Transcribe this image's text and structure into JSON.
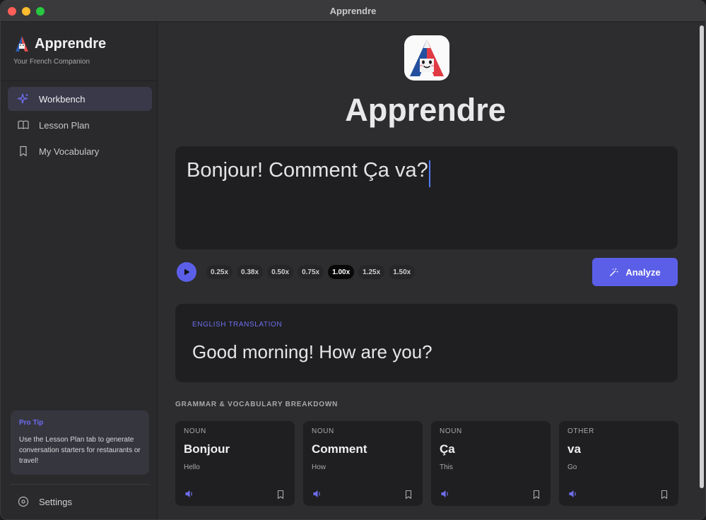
{
  "window": {
    "title": "Apprendre"
  },
  "brand": {
    "name": "Apprendre",
    "subtitle": "Your French Companion"
  },
  "sidebar": {
    "items": [
      {
        "label": "Workbench",
        "icon": "sparkle-icon",
        "active": true
      },
      {
        "label": "Lesson Plan",
        "icon": "book-icon",
        "active": false
      },
      {
        "label": "My Vocabulary",
        "icon": "bookmark-icon",
        "active": false
      }
    ],
    "tip": {
      "title": "Pro Tip",
      "body": "Use the Lesson Plan tab to generate conversation starters for restaurants or travel!"
    },
    "settings_label": "Settings"
  },
  "main": {
    "title": "Apprendre",
    "input_text": "Bonjour! Comment Ça va?",
    "speeds": [
      "0.25x",
      "0.38x",
      "0.50x",
      "0.75x",
      "1.00x",
      "1.25x",
      "1.50x"
    ],
    "selected_speed": "1.00x",
    "analyze_label": "Analyze",
    "translation": {
      "label": "ENGLISH TRANSLATION",
      "text": "Good morning! How are you?"
    },
    "breakdown": {
      "label": "GRAMMAR & VOCABULARY BREAKDOWN",
      "cards": [
        {
          "type": "NOUN",
          "word": "Bonjour",
          "meaning": "Hello"
        },
        {
          "type": "NOUN",
          "word": "Comment",
          "meaning": "How"
        },
        {
          "type": "NOUN",
          "word": "Ça",
          "meaning": "This"
        },
        {
          "type": "OTHER",
          "word": "va",
          "meaning": "Go"
        }
      ]
    }
  },
  "colors": {
    "accent": "#5b5fe8",
    "accent_text": "#6e6ff0",
    "background": "#2d2d2f",
    "panel": "#1f1f21"
  }
}
